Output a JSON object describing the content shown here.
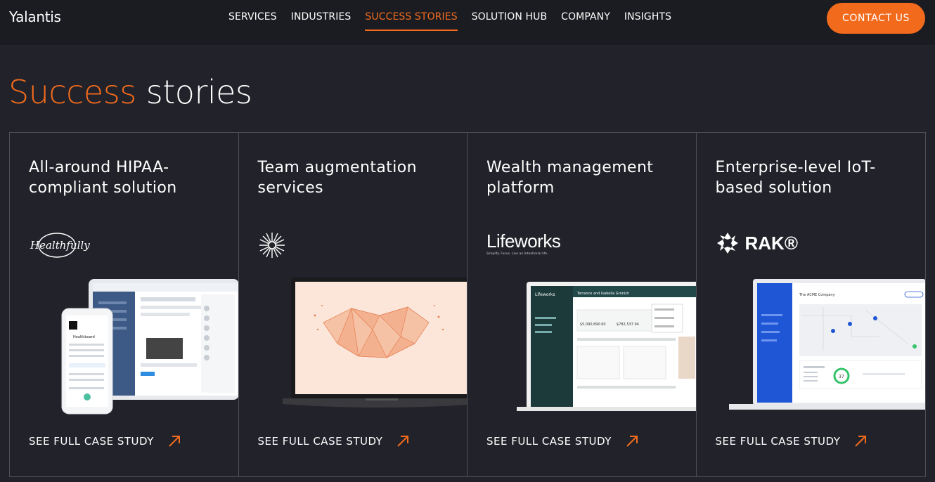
{
  "nav": {
    "logo": "Yalantis",
    "items": [
      "SERVICES",
      "INDUSTRIES",
      "SUCCESS STORIES",
      "SOLUTION HUB",
      "COMPANY",
      "INSIGHTS"
    ],
    "contact_label": "CONTACT US"
  },
  "heading": {
    "accent": "Success",
    "rest": " stories"
  },
  "cards": [
    {
      "title": "All-around HIPAA-compliant solution",
      "brand": "Healthfully",
      "cta": "SEE FULL CASE STUDY"
    },
    {
      "title": "Team augmentation services",
      "brand": "",
      "cta": "SEE FULL CASE STUDY"
    },
    {
      "title": "Wealth management platform",
      "brand": "Lifeworks",
      "brand_sub": "Simplify. Focus. Live an Intentional life.",
      "cta": "SEE FULL CASE STUDY"
    },
    {
      "title": "Enterprise-level IoT-based solution",
      "brand": "RAK®",
      "cta": "SEE FULL CASE STUDY"
    }
  ],
  "mockups": {
    "card1_phone_title": "Healthboard",
    "card3_screen_header": "Terrance and Isabella Gronich",
    "card3_sidebar_logo": "Lifeworks",
    "card3_stat_1": "$5,090,890.60",
    "card3_stat_2": "$782,537.94",
    "card4_screen_title": "The ACME Company",
    "card4_gauge_value": "37"
  },
  "colors": {
    "accent": "#f26b1d",
    "bg": "#22232a",
    "nav_bg": "#1b1c21",
    "border": "#4f5057"
  }
}
